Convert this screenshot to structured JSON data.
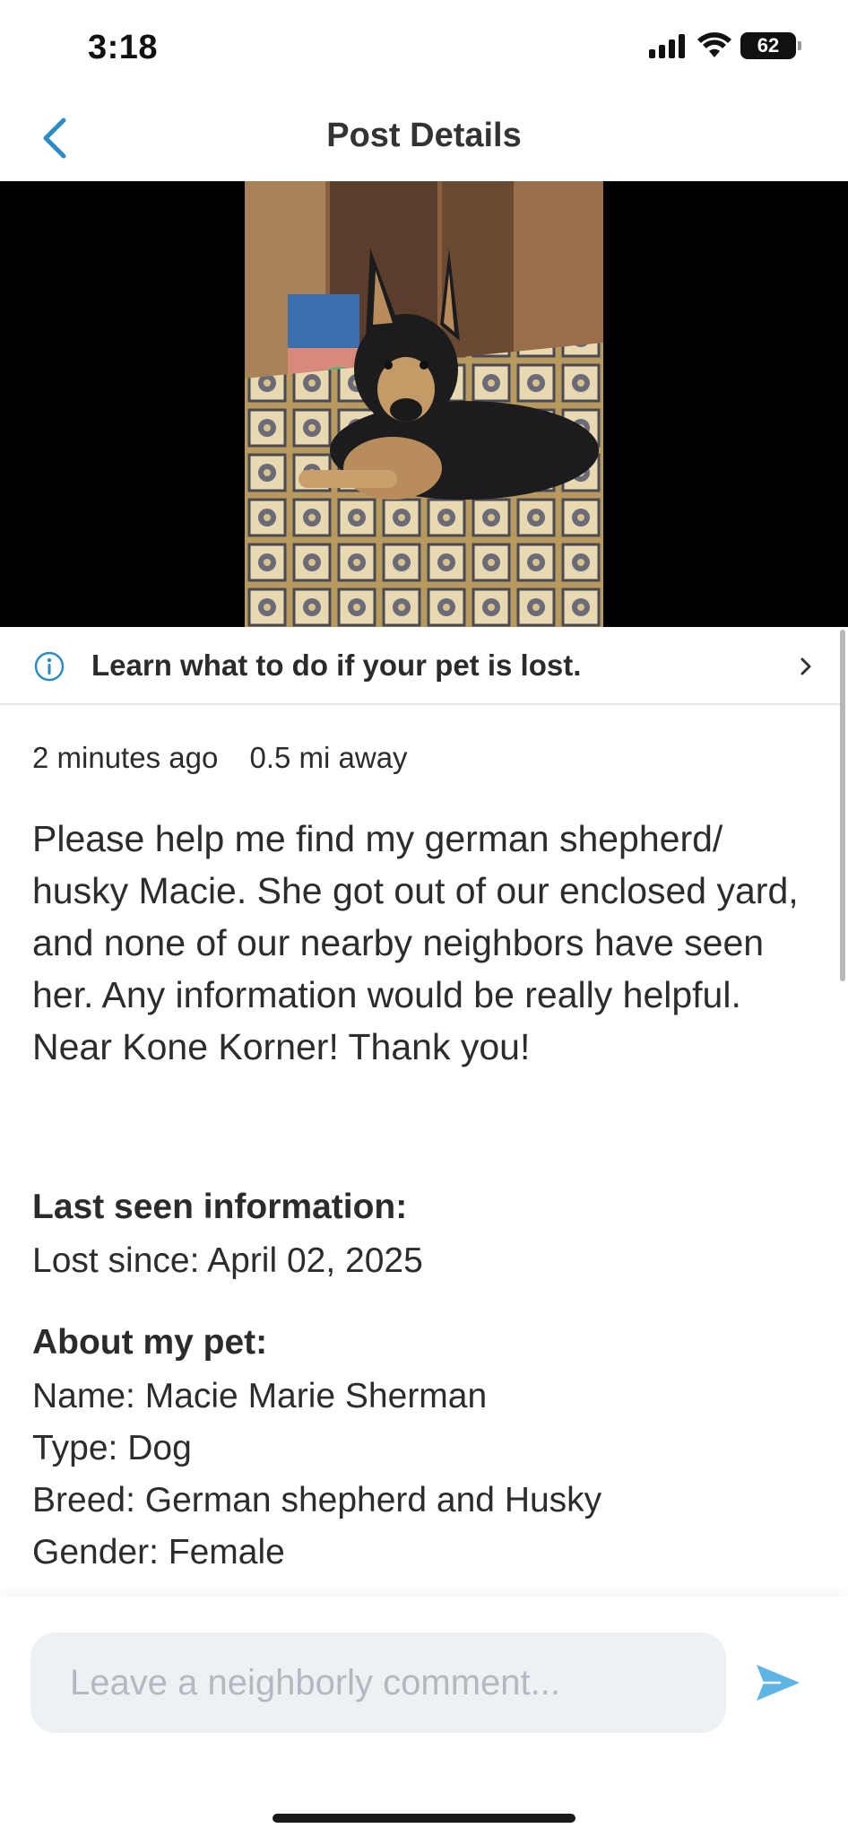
{
  "status_bar": {
    "time": "3:18",
    "battery": "62",
    "icons": [
      "signal-icon",
      "wifi-icon",
      "battery-icon"
    ]
  },
  "nav": {
    "title": "Post Details",
    "back_icon": "chevron-left-icon"
  },
  "photo": {
    "subject": "pet-photo"
  },
  "banner": {
    "text": "Learn what to do if your pet is lost.",
    "icon": "info-icon"
  },
  "meta": {
    "time_ago": "2 minutes ago",
    "distance": "0.5 mi away"
  },
  "post": {
    "body": "Please help me find my german shepherd/ husky Macie. She got out of our enclosed yard, and none of our nearby neighbors have seen her. Any information would be really helpful. Near Kone Korner! Thank you!"
  },
  "last_seen": {
    "heading": "Last seen information:",
    "lost_since": "Lost since: April 02, 2025"
  },
  "about": {
    "heading": "About my pet:",
    "name": "Name: Macie Marie Sherman",
    "type": "Type: Dog",
    "breed": "Breed: German shepherd and Husky",
    "gender": "Gender: Female"
  },
  "comment": {
    "placeholder": "Leave a neighborly comment..."
  },
  "colors": {
    "accent": "#2a8dc9",
    "send": "#5fb4e6",
    "input_bg": "#eef1f4"
  }
}
